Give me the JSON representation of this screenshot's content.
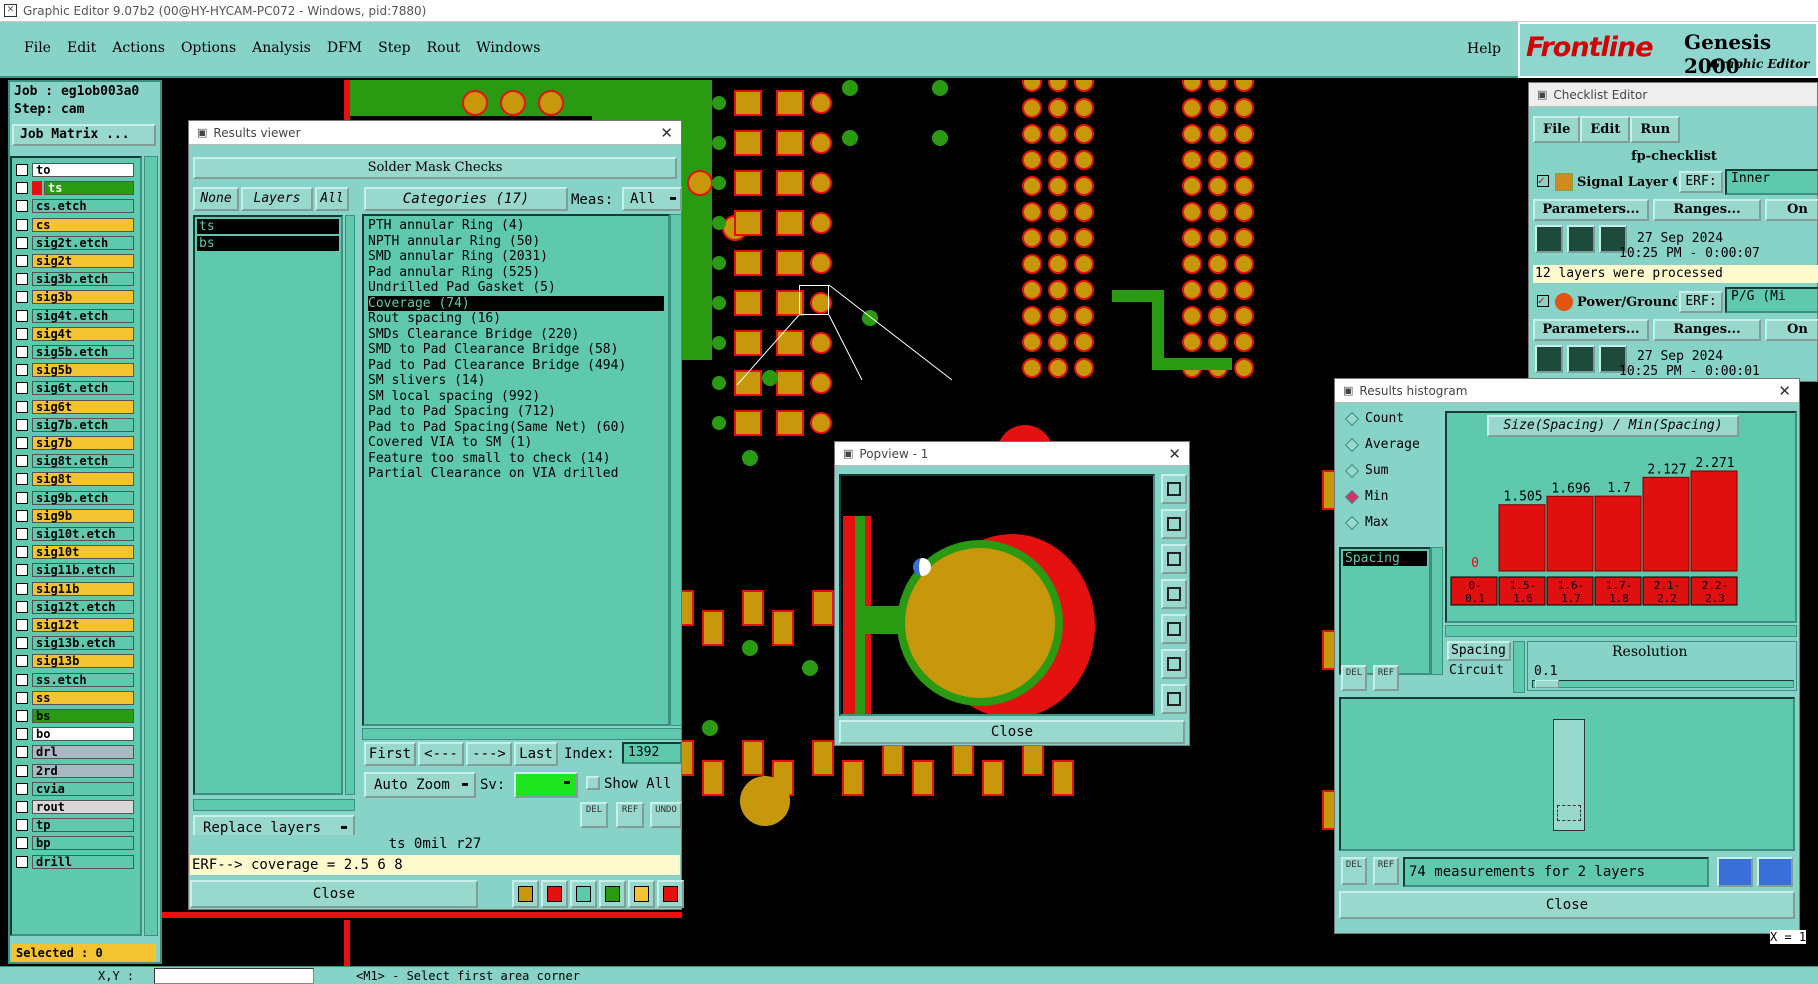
{
  "title_bar": "Graphic Editor 9.07b2 (00@HY-HYCAM-PC072 - Windows, pid:7880)",
  "menu": [
    "File",
    "Edit",
    "Actions",
    "Options",
    "Analysis",
    "DFM",
    "Step",
    "Rout",
    "Windows"
  ],
  "help": "Help",
  "brand": {
    "logo": "Frontline",
    "product": "Genesis 2000",
    "subtitle": "Graphic Editor"
  },
  "job": {
    "job_line": "Job : eg1ob003a0",
    "step_line": "Step: cam",
    "matrix_btn": "Job Matrix ..."
  },
  "layers": [
    {
      "name": "to",
      "color": "#ffffff"
    },
    {
      "name": "ts",
      "color": "#2a9a12",
      "active": true
    },
    {
      "name": "cs.etch",
      "color": "#5fc9ae"
    },
    {
      "name": "cs",
      "color": "#f4c430"
    },
    {
      "name": "sig2t.etch",
      "color": "#5fc9ae"
    },
    {
      "name": "sig2t",
      "color": "#f4c430"
    },
    {
      "name": "sig3b.etch",
      "color": "#5fc9ae"
    },
    {
      "name": "sig3b",
      "color": "#f4c430"
    },
    {
      "name": "sig4t.etch",
      "color": "#5fc9ae"
    },
    {
      "name": "sig4t",
      "color": "#f4c430"
    },
    {
      "name": "sig5b.etch",
      "color": "#5fc9ae"
    },
    {
      "name": "sig5b",
      "color": "#f4c430"
    },
    {
      "name": "sig6t.etch",
      "color": "#5fc9ae"
    },
    {
      "name": "sig6t",
      "color": "#f4c430"
    },
    {
      "name": "sig7b.etch",
      "color": "#5fc9ae"
    },
    {
      "name": "sig7b",
      "color": "#f4c430"
    },
    {
      "name": "sig8t.etch",
      "color": "#5fc9ae"
    },
    {
      "name": "sig8t",
      "color": "#f4c430"
    },
    {
      "name": "sig9b.etch",
      "color": "#5fc9ae"
    },
    {
      "name": "sig9b",
      "color": "#f4c430"
    },
    {
      "name": "sig10t.etch",
      "color": "#5fc9ae"
    },
    {
      "name": "sig10t",
      "color": "#f4c430"
    },
    {
      "name": "sig11b.etch",
      "color": "#5fc9ae"
    },
    {
      "name": "sig11b",
      "color": "#f4c430"
    },
    {
      "name": "sig12t.etch",
      "color": "#5fc9ae"
    },
    {
      "name": "sig12t",
      "color": "#f4c430"
    },
    {
      "name": "sig13b.etch",
      "color": "#5fc9ae"
    },
    {
      "name": "sig13b",
      "color": "#f4c430"
    },
    {
      "name": "ss.etch",
      "color": "#5fc9ae"
    },
    {
      "name": "ss",
      "color": "#f4c430"
    },
    {
      "name": "bs",
      "color": "#2a9a12"
    },
    {
      "name": "bo",
      "color": "#ffffff"
    },
    {
      "name": "drl",
      "color": "#a9b9c4"
    },
    {
      "name": "2rd",
      "color": "#a9b9c4"
    },
    {
      "name": "cvia",
      "color": "#5fc9ae"
    },
    {
      "name": "rout",
      "color": "#d8d8d8"
    },
    {
      "name": "tp",
      "color": "#5fc9ae"
    },
    {
      "name": "bp",
      "color": "#5fc9ae"
    },
    {
      "name": "drill",
      "color": "#5fc9ae"
    }
  ],
  "selected_label": "Selected : 0",
  "results_viewer": {
    "window_title": "Results viewer",
    "header": "Solder Mask Checks",
    "none_btn": "None",
    "layers_btn": "Layers",
    "all_btn": "All",
    "layer_list": [
      "ts",
      "bs"
    ],
    "categories_btn": "Categories (17)",
    "meas_label": "Meas:",
    "meas_value": "All",
    "categories": [
      "PTH annular Ring (4)",
      "NPTH annular Ring (50)",
      "SMD annular Ring (2031)",
      "Pad annular Ring (525)",
      "Undrilled Pad Gasket (5)",
      "Coverage (74)",
      "Rout spacing (16)",
      "SMDs Clearance Bridge (220)",
      "SMD to Pad Clearance Bridge (58)",
      "Pad to Pad Clearance Bridge (494)",
      "SM slivers (14)",
      "SM local spacing (992)",
      "Pad to Pad Spacing (712)",
      "Pad to Pad Spacing(Same Net) (60)",
      "Covered VIA to SM (1)",
      "Feature too small to check (14)",
      "Partial Clearance on VIA drilled"
    ],
    "selected_category": "Coverage (74)",
    "first": "First",
    "prev": "<---",
    "next": "--->",
    "last": "Last",
    "index_label": "Index:",
    "index_value": "1392",
    "auto_zoom": "Auto Zoom",
    "sv_label": "Sv:",
    "show_all": "Show All",
    "replace_layers": "Replace layers",
    "del": "DEL",
    "ref": "REF",
    "undo": "UNDO",
    "status_line": "ts 0mil  r27",
    "erf_line": "ERF--> coverage = 2.5 6 8",
    "close": "Close"
  },
  "popview": {
    "window_title": "Popview - 1",
    "close": "Close"
  },
  "checklist": {
    "window_title": "Checklist Editor",
    "menu": [
      "File",
      "Edit",
      "Run"
    ],
    "name": "fp-checklist",
    "item1": {
      "label": "Signal Layer Ch",
      "erf": "ERF:",
      "erf_value": "Inner",
      "params": "Parameters...",
      "ranges": "Ranges...",
      "on": "On",
      "date": "27 Sep 2024",
      "time": "10:25 PM - 0:00:07",
      "msg": "12 layers were processed"
    },
    "item2": {
      "label": "Power/Ground C",
      "erf": "ERF:",
      "erf_value": "P/G (Mi",
      "params": "Parameters...",
      "ranges": "Ranges...",
      "on": "On",
      "date": "27 Sep 2024",
      "time": "10:25 PM - 0:00:01"
    }
  },
  "histogram": {
    "window_title": "Results histogram",
    "options": [
      "Count",
      "Average",
      "Sum",
      "Min",
      "Max"
    ],
    "selected_option": "Min",
    "list_item": "Spacing",
    "chart_title": "Size(Spacing) / Min(Spacing)",
    "spacing_btn": "Spacing",
    "circuit_label": "Circuit",
    "resolution_label": "Resolution",
    "resolution_value": "0.1",
    "del": "DEL",
    "ref": "REF",
    "measurements": "74 measurements for 2 layers",
    "close": "Close"
  },
  "chart_data": {
    "type": "bar",
    "title": "Size(Spacing) / Min(Spacing)",
    "categories": [
      "0-0.1",
      "1.5-1.6",
      "1.6-1.7",
      "1.7-1.8",
      "2.1-2.2",
      "2.2-2.3"
    ],
    "values": [
      0,
      1.505,
      1.696,
      1.7,
      2.127,
      2.271
    ],
    "value_labels": [
      "0",
      "1.505",
      "1.696",
      "1.7",
      "2.127",
      "2.271"
    ],
    "bar_color": "#e01010"
  },
  "bottom": {
    "prompt": "<M1> - Select first area corner",
    "xy": "X,Y :",
    "coords_right": "X = 1"
  }
}
